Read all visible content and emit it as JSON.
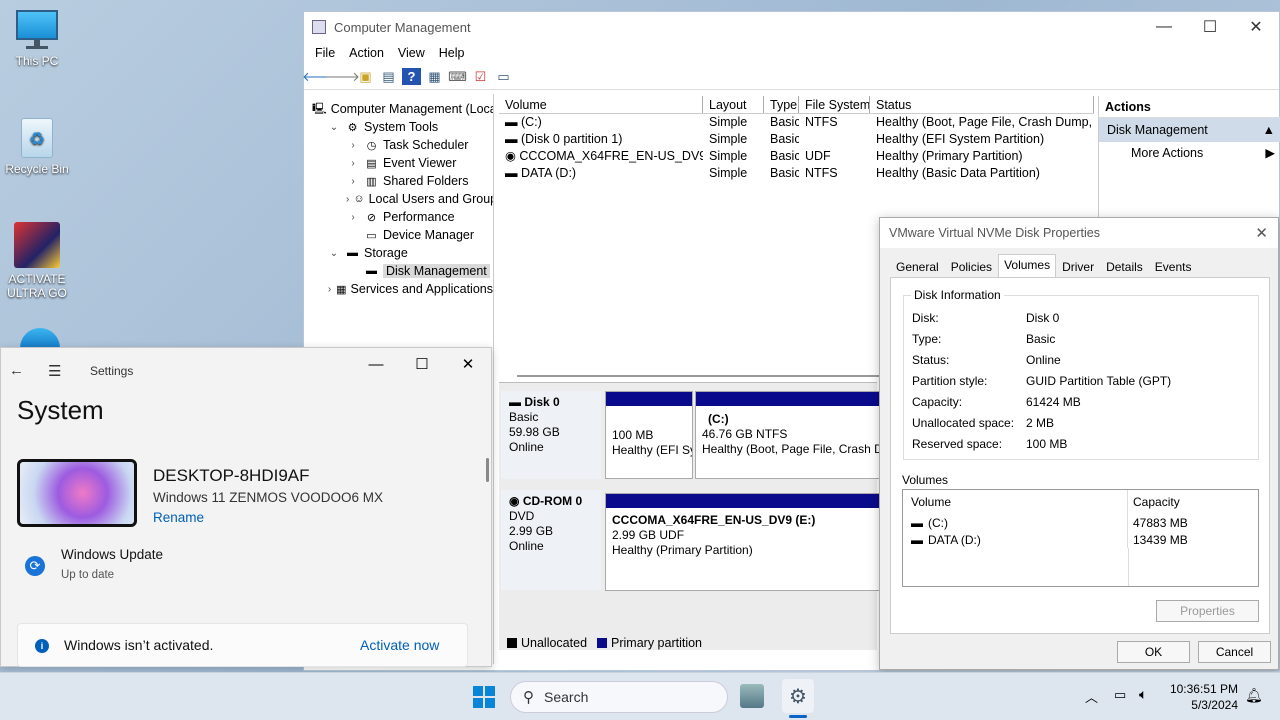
{
  "desktop": {
    "icons": [
      {
        "label": "This PC"
      },
      {
        "label": "Recycle Bin"
      },
      {
        "label": "ACTIVATE ULTRA GO"
      }
    ]
  },
  "cm": {
    "title": "Computer Management",
    "menu": [
      "File",
      "Action",
      "View",
      "Help"
    ],
    "tree": [
      {
        "label": "Computer Management (Local",
        "exp": "",
        "icon": "computer-management-icon",
        "level": 0
      },
      {
        "label": "System Tools",
        "exp": "⌄",
        "icon": "system-tools-icon",
        "level": 1
      },
      {
        "label": "Task Scheduler",
        "exp": "›",
        "icon": "clock-icon",
        "level": 2
      },
      {
        "label": "Event Viewer",
        "exp": "›",
        "icon": "event-viewer-icon",
        "level": 2
      },
      {
        "label": "Shared Folders",
        "exp": "›",
        "icon": "shared-folder-icon",
        "level": 2
      },
      {
        "label": "Local Users and Groups",
        "exp": "›",
        "icon": "users-icon",
        "level": 2
      },
      {
        "label": "Performance",
        "exp": "›",
        "icon": "performance-icon",
        "level": 2
      },
      {
        "label": "Device Manager",
        "exp": "",
        "icon": "device-manager-icon",
        "level": 2
      },
      {
        "label": "Storage",
        "exp": "⌄",
        "icon": "storage-icon",
        "level": 1
      },
      {
        "label": "Disk Management",
        "exp": "",
        "icon": "disk-management-icon",
        "level": 2,
        "selected": true
      },
      {
        "label": "Services and Applications",
        "exp": "›",
        "icon": "services-icon",
        "level": 1
      }
    ],
    "volume_columns": [
      "Volume",
      "Layout",
      "Type",
      "File System",
      "Status"
    ],
    "volumes": [
      {
        "volume": "(C:)",
        "layout": "Simple",
        "type": "Basic",
        "fs": "NTFS",
        "status": "Healthy (Boot, Page File, Crash Dump, Basi"
      },
      {
        "volume": "(Disk 0 partition 1)",
        "layout": "Simple",
        "type": "Basic",
        "fs": "",
        "status": "Healthy (EFI System Partition)"
      },
      {
        "volume": "CCCOMA_X64FRE_EN-US_DV9 (E:)",
        "layout": "Simple",
        "type": "Basic",
        "fs": "UDF",
        "status": "Healthy (Primary Partition)"
      },
      {
        "volume": "DATA (D:)",
        "layout": "Simple",
        "type": "Basic",
        "fs": "NTFS",
        "status": "Healthy (Basic Data Partition)"
      }
    ],
    "disks": [
      {
        "name": "Disk 0",
        "type": "Basic",
        "size": "59.98 GB",
        "status": "Online",
        "parts": [
          {
            "name": "",
            "size": "100 MB",
            "status": "Healthy (EFI Sy"
          },
          {
            "name": "(C:)",
            "size": "46.76 GB NTFS",
            "status": "Healthy (Boot, Page File, Crash Du"
          }
        ]
      },
      {
        "name": "CD-ROM 0",
        "type": "DVD",
        "size": "2.99 GB",
        "status": "Online",
        "parts": [
          {
            "name": "CCCOMA_X64FRE_EN-US_DV9  (E:)",
            "size": "2.99 GB UDF",
            "status": "Healthy (Primary Partition)"
          }
        ]
      }
    ],
    "legend": {
      "unallocated": "Unallocated",
      "primary": "Primary partition",
      "unallocated_color": "#000000",
      "primary_color": "#0a0a8c"
    },
    "actions": {
      "header": "Actions",
      "selected": "Disk Management",
      "more": "More Actions"
    }
  },
  "dialog": {
    "title": "VMware Virtual NVMe Disk Properties",
    "tabs": [
      "General",
      "Policies",
      "Volumes",
      "Driver",
      "Details",
      "Events"
    ],
    "active_tab": "Volumes",
    "group_title": "Disk Information",
    "info": [
      {
        "k": "Disk:",
        "v": "Disk 0"
      },
      {
        "k": "Type:",
        "v": "Basic"
      },
      {
        "k": "Status:",
        "v": "Online"
      },
      {
        "k": "Partition style:",
        "v": "GUID Partition Table (GPT)"
      },
      {
        "k": "Capacity:",
        "v": "61424 MB"
      },
      {
        "k": "Unallocated space:",
        "v": "2 MB"
      },
      {
        "k": "Reserved space:",
        "v": "100 MB"
      }
    ],
    "volumes_title": "Volumes",
    "vol_columns": [
      "Volume",
      "Capacity"
    ],
    "vols": [
      {
        "name": "(C:)",
        "cap": "47883 MB"
      },
      {
        "name": "DATA (D:)",
        "cap": "13439 MB"
      }
    ],
    "properties_btn": "Properties",
    "ok": "OK",
    "cancel": "Cancel"
  },
  "settings": {
    "app": "Settings",
    "heading": "System",
    "device_name": "DESKTOP-8HDI9AF",
    "os": "Windows 11 ZENMOS VOODOO6 MX",
    "rename": "Rename",
    "update_title": "Windows Update",
    "update_status": "Up to date",
    "activation_msg": "Windows isn’t activated.",
    "activate_link": "Activate now"
  },
  "taskbar": {
    "search_placeholder": "Search",
    "time": "10:36:51 PM",
    "date": "5/3/2024"
  }
}
